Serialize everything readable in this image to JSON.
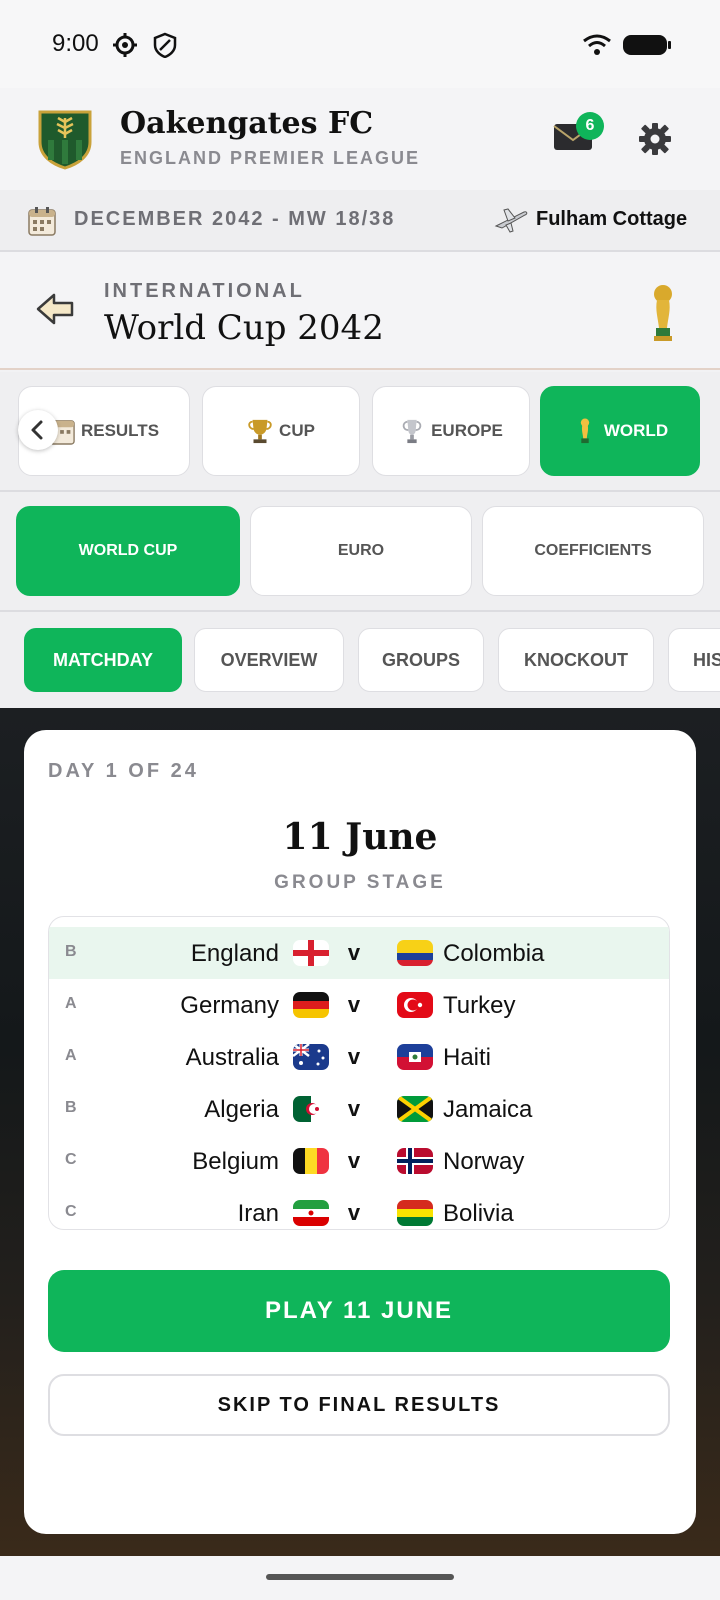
{
  "status_bar": {
    "time": "9:00"
  },
  "club": {
    "name": "Oakengates FC",
    "league": "ENGLAND PREMIER LEAGUE",
    "notifications": "6"
  },
  "date_row": {
    "date": "DECEMBER 2042 - MW 18/38",
    "venue": "Fulham Cottage"
  },
  "competition": {
    "kicker": "INTERNATIONAL",
    "title": "World Cup 2042"
  },
  "main_tabs": [
    {
      "label": "RESULTS",
      "icon": "calendar-icon"
    },
    {
      "label": "CUP",
      "icon": "cup-trophy-icon"
    },
    {
      "label": "EUROPE",
      "icon": "europe-trophy-icon"
    },
    {
      "label": "WORLD",
      "icon": "world-trophy-icon",
      "active": true
    }
  ],
  "sub_tabs": [
    {
      "label": "WORLD CUP",
      "active": true
    },
    {
      "label": "EURO"
    },
    {
      "label": "COEFFICIENTS"
    }
  ],
  "view_tabs": [
    {
      "label": "MATCHDAY",
      "active": true
    },
    {
      "label": "OVERVIEW"
    },
    {
      "label": "GROUPS"
    },
    {
      "label": "KNOCKOUT"
    },
    {
      "label": "HIS"
    }
  ],
  "matchday": {
    "day_label": "DAY 1 OF 24",
    "date": "11 June",
    "stage": "GROUP STAGE",
    "fixtures": [
      {
        "group": "B",
        "home": "England",
        "vs": "v",
        "away": "Colombia",
        "highlighted": true
      },
      {
        "group": "A",
        "home": "Germany",
        "vs": "v",
        "away": "Turkey"
      },
      {
        "group": "A",
        "home": "Australia",
        "vs": "v",
        "away": "Haiti"
      },
      {
        "group": "B",
        "home": "Algeria",
        "vs": "v",
        "away": "Jamaica"
      },
      {
        "group": "C",
        "home": "Belgium",
        "vs": "v",
        "away": "Norway"
      },
      {
        "group": "C",
        "home": "Iran",
        "vs": "v",
        "away": "Bolivia"
      }
    ],
    "play_button": "PLAY 11 JUNE",
    "skip_button": "SKIP TO FINAL RESULTS"
  },
  "colors": {
    "accent": "#0fb55a",
    "highlight_row": "#e9f6ee",
    "muted_text": "#8a8a90"
  }
}
